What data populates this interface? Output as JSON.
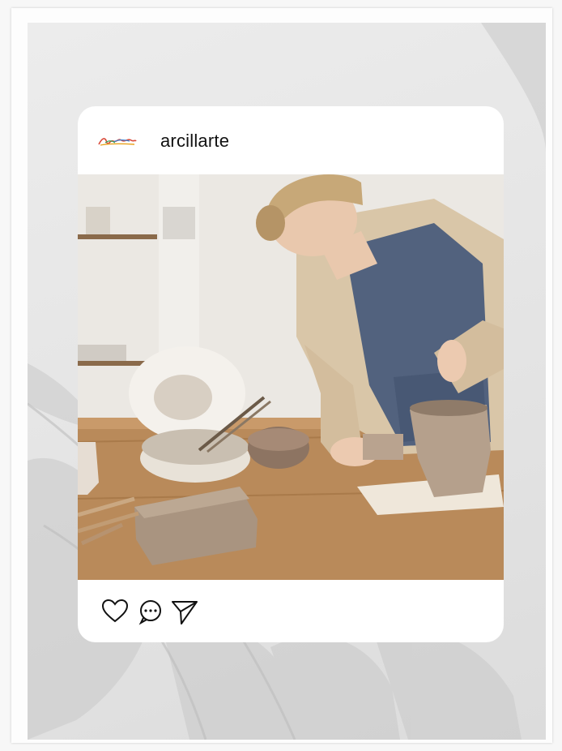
{
  "post": {
    "username": "arcillarte",
    "photo_subject": "ceramics-workshop-photo",
    "actions": [
      {
        "name": "like-button",
        "icon": "heart-icon"
      },
      {
        "name": "comment-button",
        "icon": "speech-bubble-icon"
      },
      {
        "name": "share-button",
        "icon": "paper-plane-icon"
      }
    ]
  },
  "colors": {
    "card": "#ffffff",
    "background": "#e6e6e6",
    "text": "#111111"
  }
}
